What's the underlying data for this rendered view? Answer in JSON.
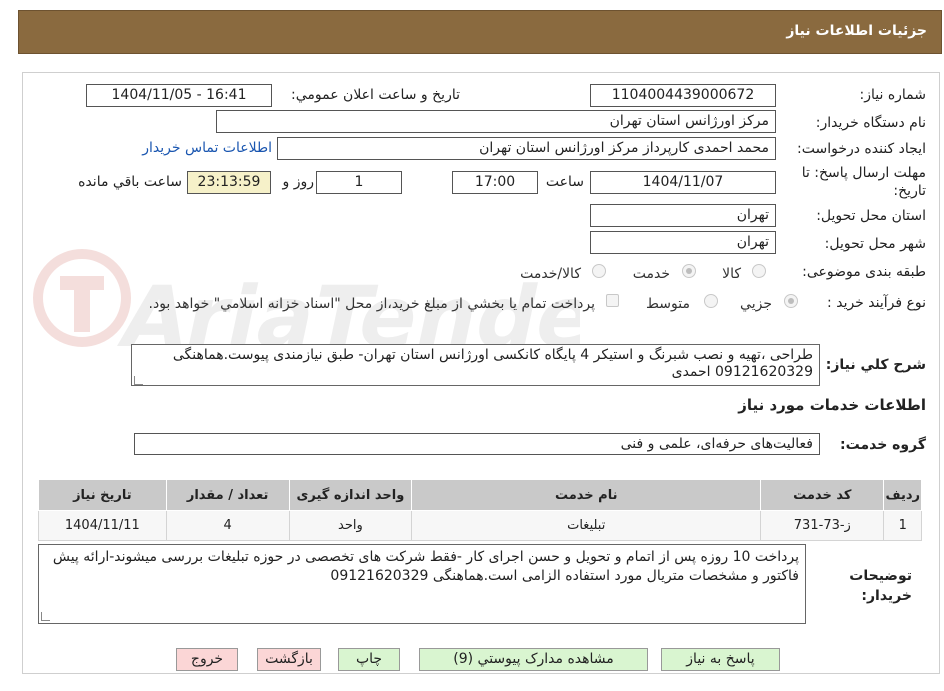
{
  "header": {
    "title": "جزئیات اطلاعات نیاز"
  },
  "form": {
    "need_number_label": "شماره نیاز:",
    "need_number": "1104004439000672",
    "announce_label": "تاریخ و ساعت اعلان عمومي:",
    "announce_value": "1404/11/05 - 16:41",
    "buyer_org_label": "نام دستگاه خريدار:",
    "buyer_org": "مرکز اورژانس استان تهران",
    "creator_label": "ايجاد کننده درخواست:",
    "creator": "محمد احمدی کارپرداز مرکز اورژانس استان تهران",
    "contact_link": "اطلاعات تماس خريدار",
    "deadline_label_1": "مهلت ارسال پاسخ: تا",
    "deadline_label_2": "تاريخ:",
    "deadline_date": "1404/11/07",
    "time_label": "ساعت",
    "deadline_time": "17:00",
    "days_value": "1",
    "days_label": "روز و",
    "remaining_time": "23:13:59",
    "remaining_label": "ساعت باقي مانده",
    "province_label": "استان محل تحويل:",
    "province": "تهران",
    "city_label": "شهر محل تحويل:",
    "city": "تهران",
    "category_label": "طبقه بندی موضوعی:",
    "category_options": [
      "کالا",
      "خدمت",
      "کالا/خدمت"
    ],
    "process_label": "نوع فرآيند خريد :",
    "process_options": [
      "جزيي",
      "متوسط"
    ],
    "payment_note": "پرداخت تمام يا بخشي از مبلغ خريد،از محل \"اسناد خزانه اسلامي\" خواهد بود.",
    "description_label": "شرح کلي نياز:",
    "description": "طراحی ،تهیه و نصب شبرنگ و استیکر  4 پایگاه کانکسی اورژانس استان تهران- طبق نیازمندی پیوست.هماهنگی 09121620329  احمدی"
  },
  "services": {
    "title": "اطلاعات خدمات مورد نياز",
    "group_label": "گروه خدمت:",
    "group_value": "فعاليت‌های حرفه‌ای، علمی و فنی",
    "columns": [
      "رديف",
      "کد خدمت",
      "نام خدمت",
      "واحد اندازه گيری",
      "تعداد / مقدار",
      "تاريخ نياز"
    ],
    "rows": [
      [
        "1",
        "ز-73-731",
        "تبلیغات",
        "واحد",
        "4",
        "1404/11/11"
      ]
    ]
  },
  "buyer_notes": {
    "label": "توضيحات خريدار:",
    "text": "پرداخت 10 روزه پس از اتمام و تحویل و حسن اجرای کار -فقط شرکت های تخصصی در حوزه تبلیغات بررسی میشوند-ارائه پیش فاکتور و مشخصات متریال مورد استفاده الزامی است.هماهنگی 09121620329"
  },
  "buttons": {
    "reply": "پاسخ به نياز",
    "attachments": "مشاهده مدارک پيوستي (9)",
    "print": "چاپ",
    "back": "بازگشت",
    "exit": "خروج"
  },
  "watermark": {
    "text": "AriaTender.neT"
  },
  "colors": {
    "header_bg": "#8a6a3f",
    "link": "#1a56b0",
    "button_green": "#d9f5d0",
    "button_pink": "#fbd6d6"
  }
}
